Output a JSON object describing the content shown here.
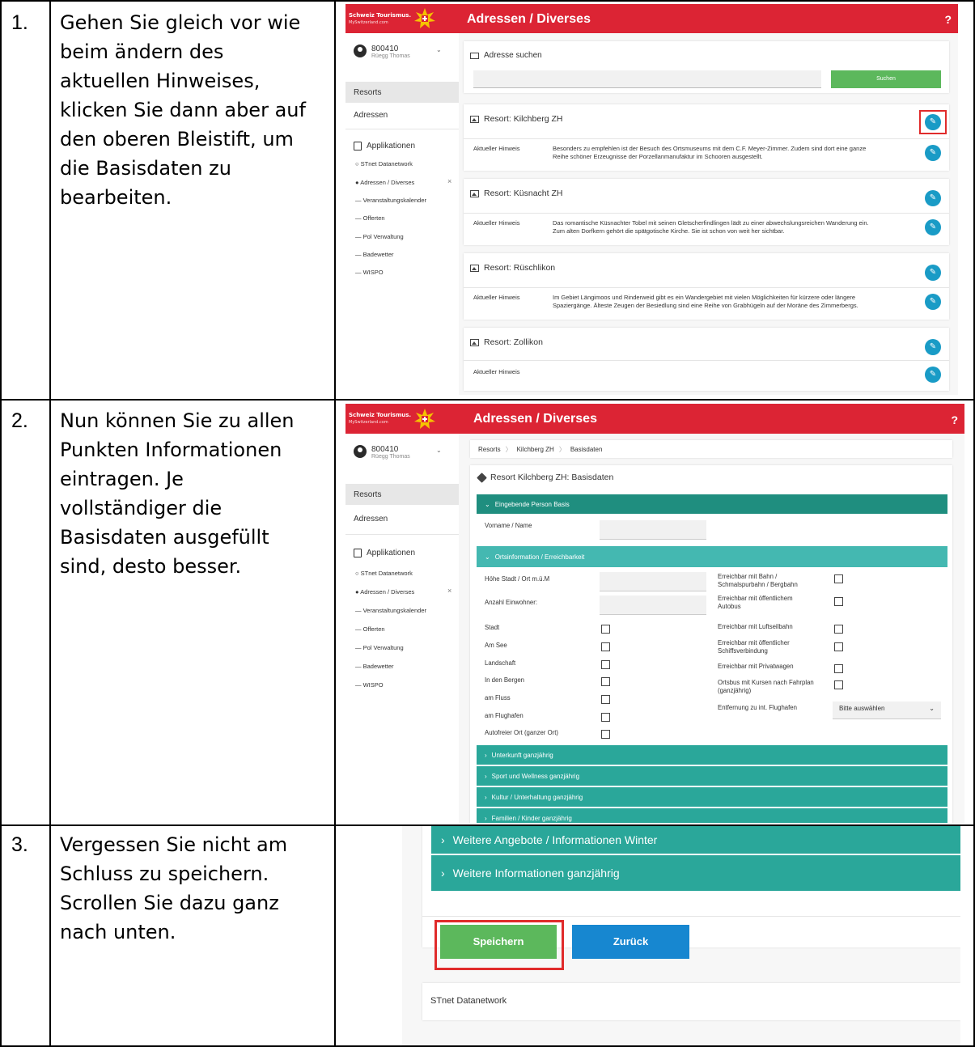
{
  "rows": [
    {
      "number": "1.",
      "text": "Gehen Sie gleich vor wie\nbeim ändern des\naktuellen Hinweises,\nklicken Sie dann aber auf\nden oberen Bleistift, um\ndie Basisdaten zu\nbearbeiten."
    },
    {
      "number": "2.",
      "text": "Nun können Sie zu allen\nPunkten Informationen\neintragen. Je\nvollständiger die\nBasisdaten ausgefüllt\nsind, desto besser."
    },
    {
      "number": "3.",
      "text": "Vergessen Sie nicht am\nSchluss zu speichern.\nScrollen Sie dazu ganz\nnach unten."
    }
  ],
  "app": {
    "brand": "Schweiz Tourismus.",
    "brand_sub": "MySwitzerland.com",
    "title": "Adressen / Diverses",
    "help": "?",
    "user_id": "800410",
    "user_name": "Rüegg Thomas",
    "sidebar": {
      "resorts": "Resorts",
      "adressen": "Adressen",
      "applikationen": "Applikationen",
      "items": [
        "STnet Datanetwork",
        "Adressen / Diverses",
        "Veranstaltungskalender",
        "Offerten",
        "Pol Verwaltung",
        "Badewetter",
        "WISPO"
      ]
    },
    "colors": {
      "brand_red": "#dc2434",
      "teal": "#2aa79a",
      "pencil_blue": "#199bc6",
      "save_green": "#5cb85c",
      "back_blue": "#1787d0",
      "highlight_red": "#e02b2b"
    }
  },
  "shot1": {
    "search_label": "Adresse suchen",
    "search_button": "Suchen",
    "hint_label": "Aktueller Hinweis",
    "resorts": [
      {
        "title": "Resort: Kilchberg ZH",
        "hint": "Besonders zu empfehlen ist der Besuch des Ortsmuseums mit dem C.F. Meyer-Zimmer. Zudem sind dort eine ganze\nReihe schöner Erzeugnisse der Porzellanmanufaktur im Schooren ausgestellt."
      },
      {
        "title": "Resort: Küsnacht ZH",
        "hint": "Das romantische Küsnachter Tobel mit seinen Gletscherfindlingen lädt zu einer abwechslungsreichen Wanderung ein.\nZum alten Dorfkern gehört die spätgotische Kirche. Sie ist schon von weit her sichtbar."
      },
      {
        "title": "Resort: Rüschlikon",
        "hint": "Im Gebiet Längimoos und Rinderweid gibt es ein Wandergebiet mit vielen Möglichkeiten für kürzere oder längere\nSpaziergänge. Älteste Zeugen der Besiedlung sind eine Reihe von Grabhügeln auf der Moräne des Zimmerbergs."
      },
      {
        "title": "Resort: Zollikon",
        "hint": ""
      }
    ]
  },
  "shot2": {
    "breadcrumb": [
      "Resorts",
      "Kilchberg ZH",
      "Basisdaten"
    ],
    "card_title": "Resort Kilchberg ZH: Basisdaten",
    "section_person": "Eingebende Person Basis",
    "field_name": "Vorname / Name",
    "section_ort": "Ortsinformation / Erreichbarkeit",
    "left_inputs": [
      "Höhe Stadt / Ort m.ü.M",
      "Anzahl Einwohner:"
    ],
    "left_checks": [
      "Stadt",
      "Am See",
      "Landschaft",
      "In den Bergen",
      "am Fluss",
      "am Flughafen",
      "Autofreier Ort (ganzer Ort)"
    ],
    "right_checks": [
      "Erreichbar mit Bahn /\nSchmalspurbahn / Bergbahn",
      "Erreichbar mit öffentlichem\nAutobus",
      "Erreichbar mit Luftseilbahn",
      "Erreichbar mit öffentlicher\nSchiffsverbindung",
      "Erreichbar mit Privatwagen",
      "Ortsbus mit Kursen nach Fahrplan\n(ganzjährig)"
    ],
    "airport_label": "Entfernung zu int. Flughafen",
    "airport_select": "Bitte auswählen",
    "collapsed_sections": [
      "Unterkunft ganzjährig",
      "Sport und Wellness ganzjährig",
      "Kultur / Unterhaltung ganzjährig",
      "Familien / Kinder ganzjährig"
    ]
  },
  "shot3": {
    "sections": [
      "Weitere Angebote / Informationen Winter",
      "Weitere Informationen ganzjährig"
    ],
    "save_label": "Speichern",
    "back_label": "Zurück",
    "footer": "STnet Datanetwork"
  }
}
